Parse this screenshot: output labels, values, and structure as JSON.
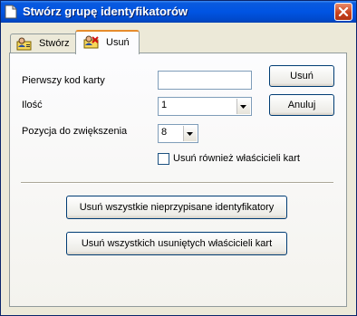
{
  "window": {
    "title": "Stwórz grupę identyfikatorów",
    "icons": {
      "app": "document-icon",
      "close": "close-icon"
    }
  },
  "tabs": [
    {
      "label": "Stwórz",
      "icon": "user-card-icon",
      "selected": false
    },
    {
      "label": "Usuń",
      "icon": "user-card-delete-icon",
      "selected": true
    }
  ],
  "form": {
    "first_card_code_label": "Pierwszy kod karty",
    "first_card_code_value": "",
    "quantity_label": "Ilość",
    "quantity_value": "1",
    "position_label": "Pozycja do zwiększenia",
    "position_value": "8",
    "also_delete_owners_label": "Usuń również właścicieli kart",
    "also_delete_owners_checked": false
  },
  "buttons": {
    "delete": "Usuń",
    "cancel": "Anuluj",
    "delete_unassigned": "Usuń wszystkie nieprzypisane identyfikatory",
    "delete_removed_owners": "Usuń wszystkich usuniętych właścicieli kart"
  },
  "colors": {
    "titlebar": "#0054e3",
    "close_button": "#c8441f",
    "tab_accent": "#e68b2c",
    "dialog_background": "#ece9d8"
  }
}
